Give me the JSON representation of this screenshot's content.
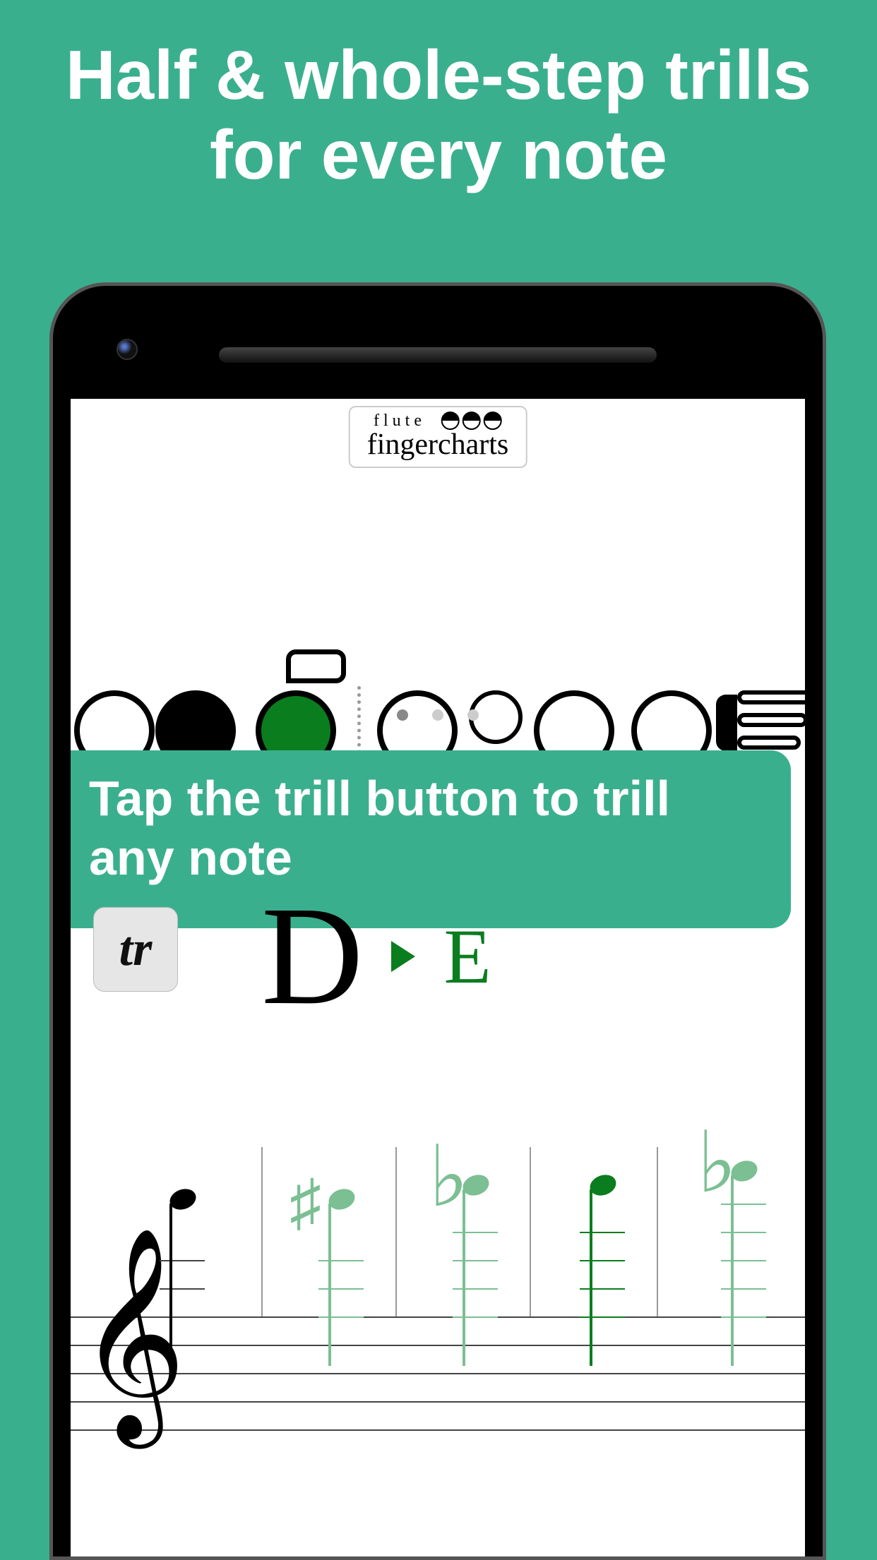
{
  "headline": "Half & whole-step trills for every note",
  "logo": {
    "small": "flute",
    "main": "fingercharts"
  },
  "fingering": {
    "keys": [
      {
        "state": "open"
      },
      {
        "state": "closed"
      },
      {
        "state": "trill"
      },
      {
        "state": "open"
      },
      {
        "state": "open"
      },
      {
        "state": "open"
      }
    ],
    "page": {
      "current": 1,
      "total": 3
    }
  },
  "callout": "Tap the trill button to trill any note",
  "trill_button": "tr",
  "note": {
    "from": "D",
    "to": "E"
  },
  "staff_notes": [
    {
      "accidental": "",
      "role": "from"
    },
    {
      "accidental": "sharp",
      "role": "to-option"
    },
    {
      "accidental": "flat",
      "role": "to-option"
    },
    {
      "accidental": "",
      "role": "to-selected"
    },
    {
      "accidental": "flat",
      "role": "to-option"
    }
  ]
}
